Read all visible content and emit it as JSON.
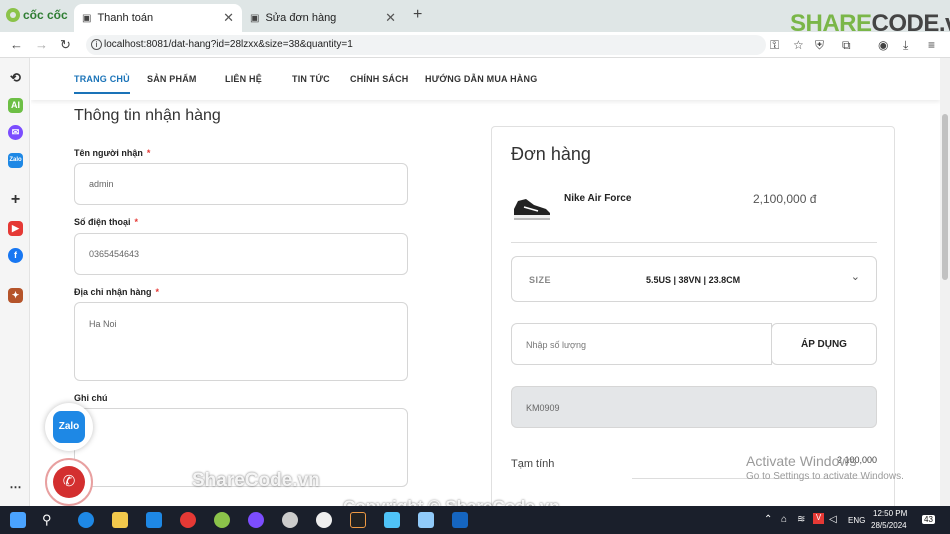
{
  "browser": {
    "brand": "cốc cốc",
    "tabs": [
      {
        "label": "Thanh toán",
        "active": true
      },
      {
        "label": "Sửa đơn hàng",
        "active": false
      }
    ],
    "url": "localhost:8081/dat-hang?id=28lzxx&size=38&quantity=1",
    "watermark_logo": {
      "part1": "SHARE",
      "part2": "CODE.vn"
    }
  },
  "nav": {
    "items": [
      "TRANG CHỦ",
      "SẢN PHẨM",
      "LIÊN HỆ",
      "TIN TỨC",
      "CHÍNH SÁCH",
      "HƯỚNG DẪN MUA HÀNG"
    ],
    "active_index": 0
  },
  "form": {
    "title": "Thông tin nhận hàng",
    "name_label": "Tên người nhận",
    "name_value": "admin",
    "phone_label": "Số điện thoại",
    "phone_value": "0365454643",
    "address_label": "Địa chỉ nhận hàng",
    "address_value": "Ha Noi",
    "note_label": "Ghi chú",
    "required_mark": "*"
  },
  "order": {
    "title": "Đơn hàng",
    "product_name": "Nike Air Force",
    "product_price": "2,100,000 đ",
    "size_label": "SIZE",
    "size_value": "5.5US | 38VN | 23.8CM",
    "quantity_placeholder": "Nhập số lượng",
    "apply_label": "ÁP DỤNG",
    "promo_value": "KM0909",
    "subtotal_label": "Tạm tính",
    "subtotal_value": "2,100,000"
  },
  "floating": {
    "zalo_label": "Zalo"
  },
  "overlays": {
    "activate_title": "Activate Windows",
    "activate_sub": "Go to Settings to activate Windows.",
    "sharecode_center": "ShareCode.vn",
    "sharecode_copyright": "Copyright © ShareCode.vn"
  },
  "taskbar": {
    "lang": "ENG",
    "time": "12:50 PM",
    "date": "28/5/2024",
    "notif_count": "43"
  },
  "colors": {
    "accent": "#1a73b8",
    "required": "#e53935",
    "zalo": "#1e88e5",
    "call": "#d32f2f"
  }
}
